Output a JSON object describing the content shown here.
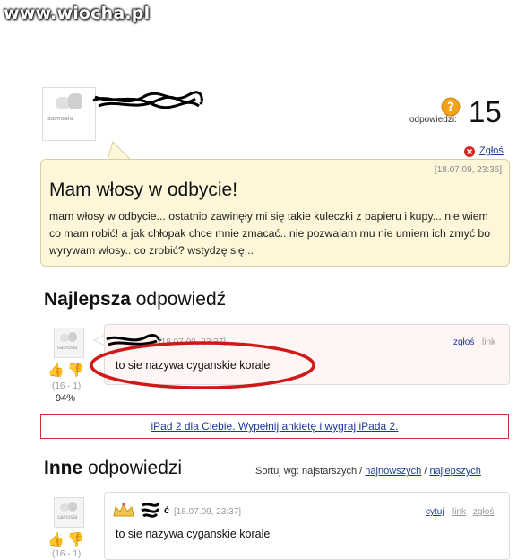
{
  "watermark": "www.wiocha.pl",
  "question": {
    "avatar_label": "samosia",
    "count_label": "odpowiedzi:",
    "count": "15",
    "report": "Zgłoś",
    "date": "[18.07.09, 23:36]",
    "title": "Mam włosy w odbycie!",
    "body": "mam włosy w odbycie... ostatnio zawinęły mi się takie kuleczki z papieru i kupy... nie wiem co mam robić! a jak chłopak chce mnie zmacać.. nie pozwalam mu nie umiem ich zmyć bo wyrywam włosy.. co zrobić? wstydzę się..."
  },
  "best": {
    "heading_bold": "Najlepsza",
    "heading_rest": " odpowiedź",
    "avatar_label": "samosia",
    "votes": "(16 - 1)",
    "percent": "94%",
    "date": "[18.07.09, 23:37]",
    "report": "zgłoś",
    "link": "link",
    "text": "to sie nazywa cyganskie korale"
  },
  "ad": {
    "text": "iPad 2 dla Ciebie. Wypełnij ankietę i wygraj iPada 2."
  },
  "others": {
    "heading_bold": "Inne",
    "heading_rest": " odpowiedzi",
    "sort_prefix": "Sortuj wg: najstarszych / ",
    "sort_newest": "najnowszych",
    "sort_sep": " / ",
    "sort_best": "najlepszych"
  },
  "answer2": {
    "avatar_label": "samosia",
    "name_suffix": "ć",
    "date": "[18.07.09, 23:37]",
    "cite": "cytuj",
    "link": "link",
    "report": "zgłoś",
    "text": "to sie nazywa cyganskie korale",
    "votes": "(16 - 1)"
  },
  "colors": {
    "accent_link": "#1a3b8f",
    "question_bg": "#fdf6d8",
    "highlight_oval": "#d01818",
    "ad_border": "#cc3333"
  }
}
